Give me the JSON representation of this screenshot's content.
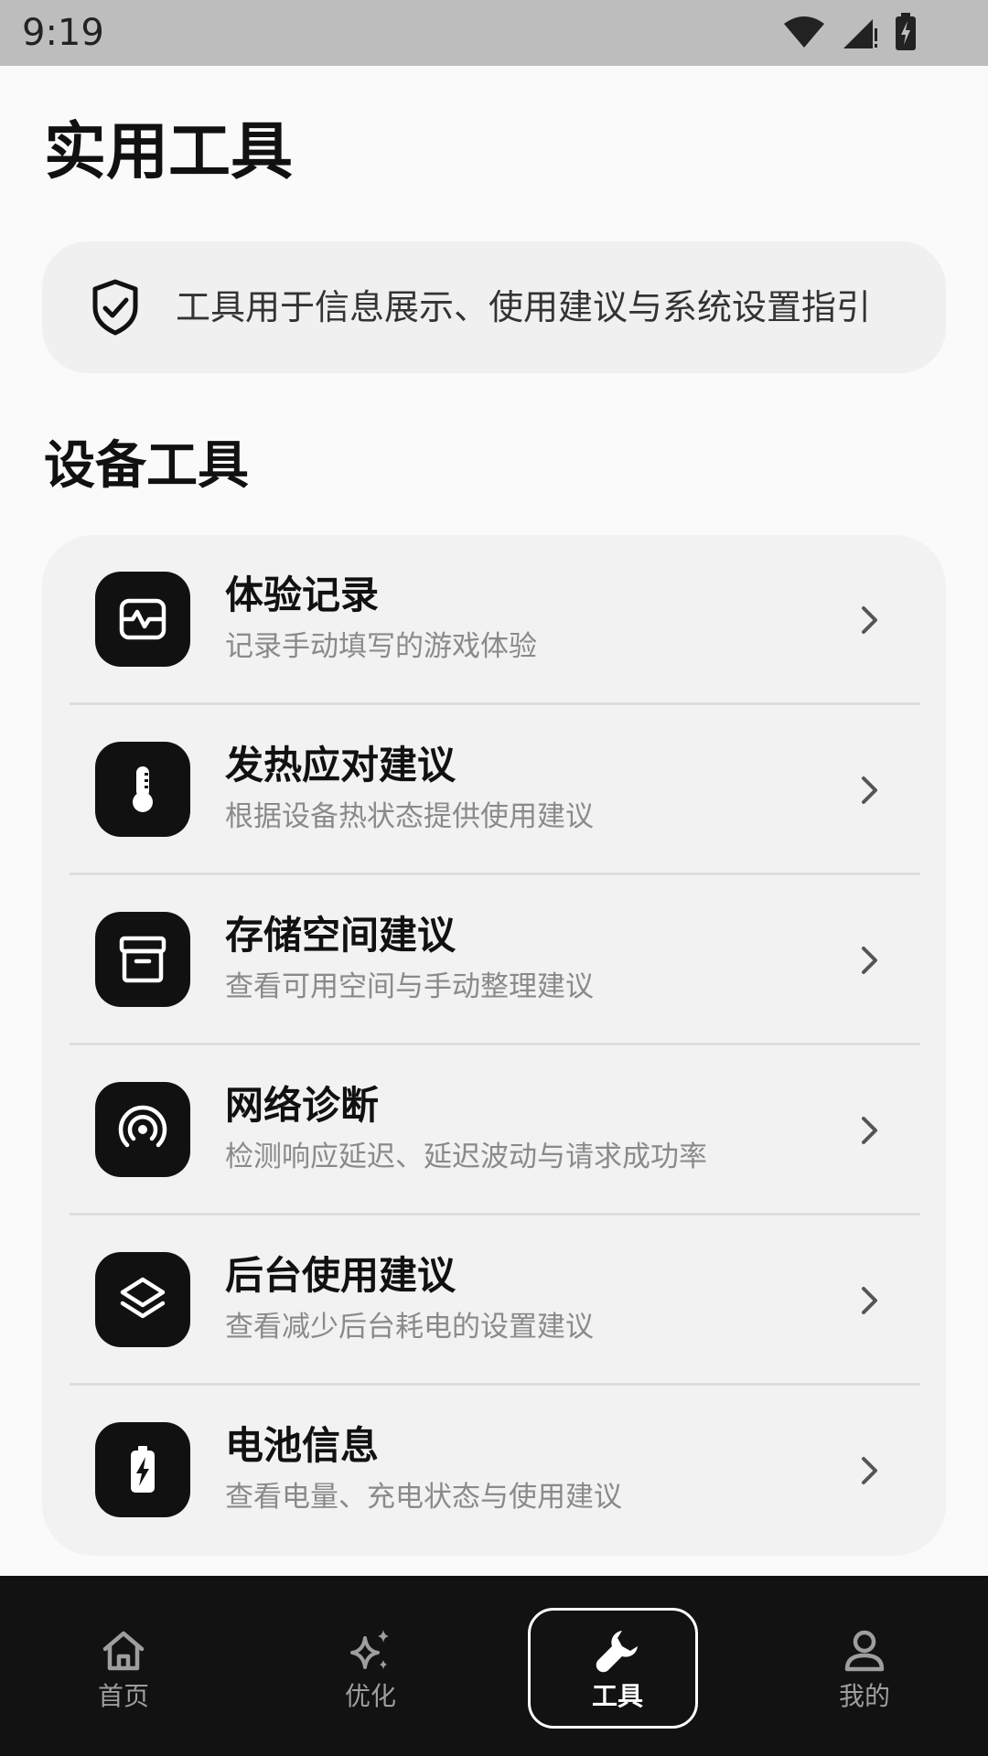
{
  "status_bar": {
    "time": "9:19",
    "icons": [
      "wifi-icon",
      "signal-icon",
      "battery-charging-icon"
    ]
  },
  "page": {
    "title": "实用工具"
  },
  "notice": {
    "icon": "shield-check-icon",
    "text": "工具用于信息展示、使用建议与系统设置指引"
  },
  "section": {
    "title": "设备工具"
  },
  "tools": [
    {
      "icon": "activity-icon",
      "title": "体验记录",
      "desc": "记录手动填写的游戏体验"
    },
    {
      "icon": "thermometer-icon",
      "title": "发热应对建议",
      "desc": "根据设备热状态提供使用建议"
    },
    {
      "icon": "archive-icon",
      "title": "存储空间建议",
      "desc": "查看可用空间与手动整理建议"
    },
    {
      "icon": "broadcast-icon",
      "title": "网络诊断",
      "desc": "检测响应延迟、延迟波动与请求成功率"
    },
    {
      "icon": "layers-icon",
      "title": "后台使用建议",
      "desc": "查看减少后台耗电的设置建议"
    },
    {
      "icon": "battery-icon",
      "title": "电池信息",
      "desc": "查看电量、充电状态与使用建议"
    }
  ],
  "bottom_nav": {
    "items": [
      {
        "icon": "home-icon",
        "label": "首页",
        "active": false
      },
      {
        "icon": "sparkles-icon",
        "label": "优化",
        "active": false
      },
      {
        "icon": "wrench-icon",
        "label": "工具",
        "active": true
      },
      {
        "icon": "user-icon",
        "label": "我的",
        "active": false
      }
    ]
  },
  "colors": {
    "background": "#FAFAFA",
    "card": "#F2F2F2",
    "icon_tile": "#111111",
    "nav_background": "#121212",
    "secondary_text": "#8A8A8A"
  }
}
